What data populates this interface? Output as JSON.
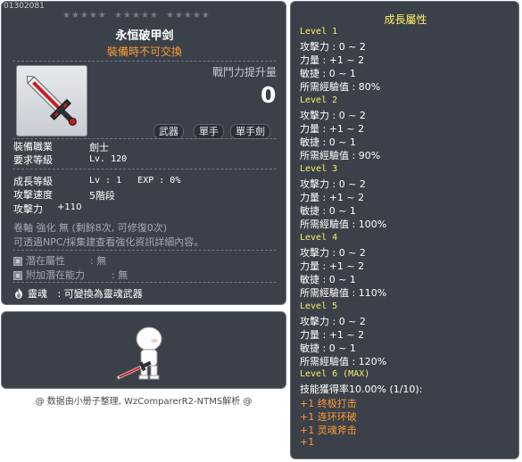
{
  "item": {
    "id": "01302081",
    "stars": [
      "★★★★★",
      "★★★★★",
      "★★★★★"
    ],
    "name": "永恒破甲剑",
    "trade_note": "裝備時不可交換",
    "power_label": "戰鬥力提升量",
    "power_value": "0",
    "tags": [
      "武器",
      "單手",
      "單手劍"
    ],
    "job_label": "裝備職業",
    "job_value": "劍士",
    "req_level_label": "要求等級",
    "req_level_value": "Lv. 120",
    "growth_level_label": "成長等級",
    "growth_level_value": "Lv : 1   EXP : 0%",
    "attack_speed_label": "攻擊速度",
    "attack_speed_value": "5階段",
    "attack_label": "攻擊力",
    "attack_value": "+110",
    "scroll_line": "卷軸 強化 無 (剩餘8次, 可修復0次)",
    "enhance_note": "可透過NPC/採集建查看強化資訊詳細內容。",
    "potential_label": "潛在屬性",
    "potential_value": ": 無",
    "bonus_potential_label": "附加潛在能力",
    "bonus_potential_value": ": 無",
    "soul_label": "靈魂",
    "soul_value": ": 可變換為靈魂武器"
  },
  "credit": "@ 数据由小册子整理, WzComparerR2-NTMS解析 @",
  "growth": {
    "title": "成長屬性",
    "levels": [
      {
        "header": "Level 1",
        "lines": [
          "攻擊力 : 0 ~ 2",
          "力量 : +1 ~ 2",
          "敏捷 : 0 ~ 1",
          "所需經驗值 : 80%"
        ]
      },
      {
        "header": "Level 2",
        "lines": [
          "攻擊力 : 0 ~ 2",
          "力量 : +1 ~ 2",
          "敏捷 : 0 ~ 1",
          "所需經驗值 : 90%"
        ]
      },
      {
        "header": "Level 3",
        "lines": [
          "攻擊力 : 0 ~ 2",
          "力量 : +1 ~ 2",
          "敏捷 : 0 ~ 1",
          "所需經驗值 : 100%"
        ]
      },
      {
        "header": "Level 4",
        "lines": [
          "攻擊力 : 0 ~ 2",
          "力量 : +1 ~ 2",
          "敏捷 : 0 ~ 1",
          "所需經驗值 : 110%"
        ]
      },
      {
        "header": "Level 5",
        "lines": [
          "攻擊力 : 0 ~ 2",
          "力量 : +1 ~ 2",
          "敏捷 : 0 ~ 1",
          "所需經驗值 : 120%"
        ]
      }
    ],
    "final_header": "Level 6 (MAX)",
    "final_line": "技能獲得率10.00% (1/10):",
    "skills": [
      "+1  终极打击",
      "+1  连环环破",
      "+1  灵魂斧击",
      "+1"
    ]
  }
}
